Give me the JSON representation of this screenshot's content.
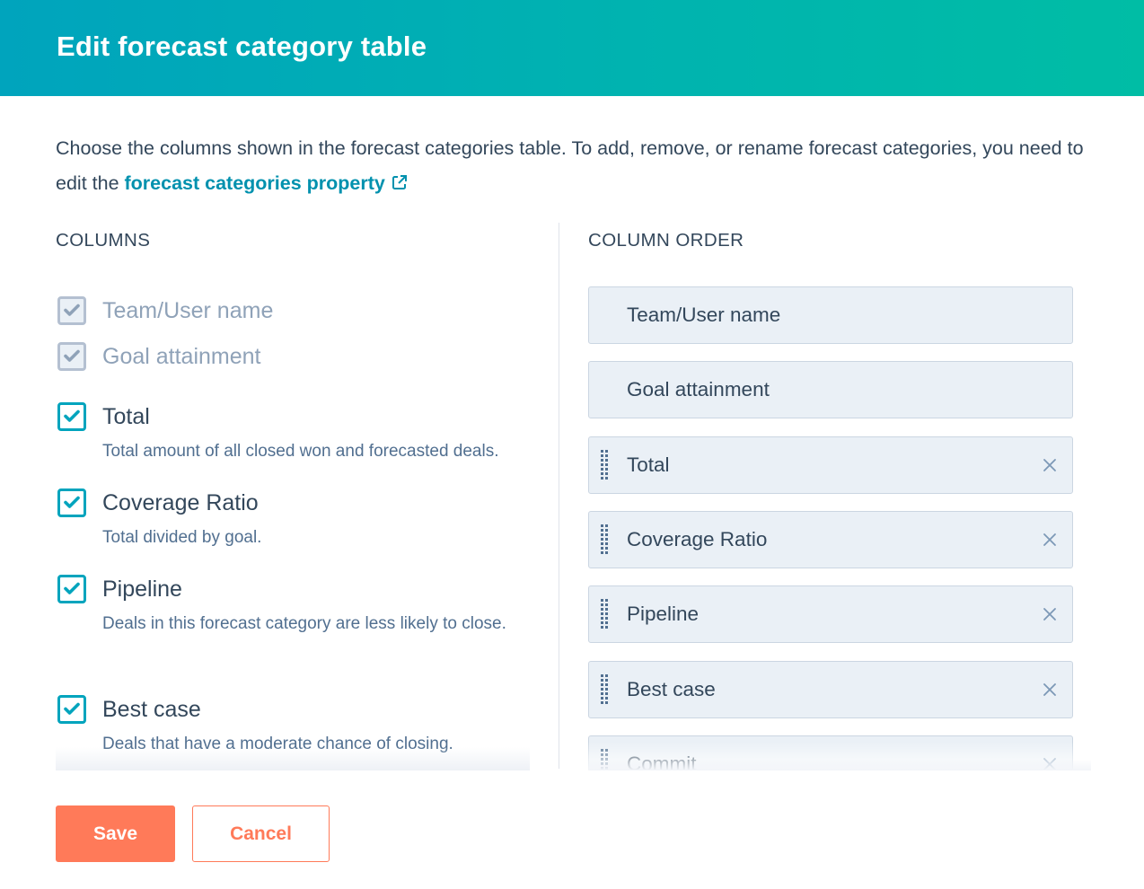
{
  "dialog": {
    "title": "Edit forecast category table",
    "intro_text": "Choose the columns shown in the forecast categories table. To add, remove, or rename forecast categories, you need to edit the ",
    "intro_link": "forecast categories property",
    "intro_link_icon": "external-link-icon"
  },
  "columns": {
    "heading": "COLUMNS",
    "items": [
      {
        "label": "Team/User name",
        "checked": true,
        "disabled": true,
        "description": ""
      },
      {
        "label": "Goal attainment",
        "checked": true,
        "disabled": true,
        "description": ""
      },
      {
        "label": "Total",
        "checked": true,
        "disabled": false,
        "description": "Total amount of all closed won and forecasted deals."
      },
      {
        "label": "Coverage Ratio",
        "checked": true,
        "disabled": false,
        "description": "Total divided by goal."
      },
      {
        "label": "Pipeline",
        "checked": true,
        "disabled": false,
        "description": "Deals in this forecast category are less likely to close."
      },
      {
        "label": "Best case",
        "checked": true,
        "disabled": false,
        "description": "Deals that have a moderate chance of closing."
      }
    ]
  },
  "column_order": {
    "heading": "COLUMN ORDER",
    "items": [
      {
        "label": "Team/User name",
        "draggable": false,
        "removable": false
      },
      {
        "label": "Goal attainment",
        "draggable": false,
        "removable": false
      },
      {
        "label": "Total",
        "draggable": true,
        "removable": true
      },
      {
        "label": "Coverage Ratio",
        "draggable": true,
        "removable": true
      },
      {
        "label": "Pipeline",
        "draggable": true,
        "removable": true
      },
      {
        "label": "Best case",
        "draggable": true,
        "removable": true
      },
      {
        "label": "Commit",
        "draggable": true,
        "removable": true
      }
    ]
  },
  "footer": {
    "save_label": "Save",
    "cancel_label": "Cancel"
  },
  "colors": {
    "header_gradient_start": "#00a4bd",
    "header_gradient_end": "#00bda5",
    "link": "#0091ae",
    "checkbox_accent": "#00a4bd",
    "primary_button": "#ff7a59",
    "text": "#33475b",
    "muted_text": "#516f90",
    "disabled_text": "#8fa2b8",
    "order_item_bg": "#eaf0f6"
  }
}
